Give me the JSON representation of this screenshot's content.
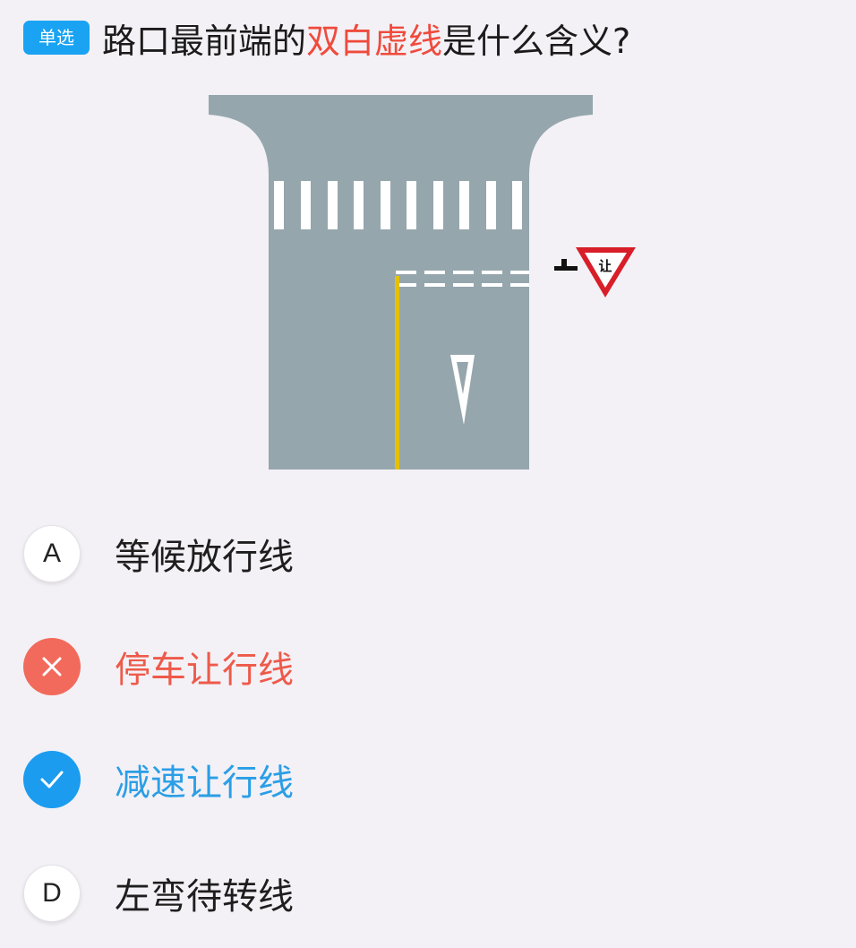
{
  "question": {
    "type_badge": "单选",
    "prefix": "路口最前端的",
    "highlight": "双白虚线",
    "suffix": "是什么含义?"
  },
  "diagram": {
    "sign_text": "让",
    "icons": [
      "yield-sign-icon",
      "direction-triangle-icon"
    ]
  },
  "options": [
    {
      "letter": "A",
      "label": "等候放行线",
      "state": "normal"
    },
    {
      "letter": "",
      "label": "停车让行线",
      "state": "wrong",
      "icon": "close-icon"
    },
    {
      "letter": "",
      "label": "减速让行线",
      "state": "correct",
      "icon": "check-icon"
    },
    {
      "letter": "D",
      "label": "左弯待转线",
      "state": "normal"
    }
  ],
  "colors": {
    "background": "#f3f1f6",
    "badge": "#1aa3f2",
    "highlight": "#ef4b3c",
    "wrong": "#f26a5b",
    "wrong_text": "#ee5a4a",
    "correct": "#1b9cef",
    "correct_text": "#2b9ee6",
    "road": "#96a6ad",
    "yellow_line": "#e5c000",
    "sign_red": "#d81e28"
  }
}
